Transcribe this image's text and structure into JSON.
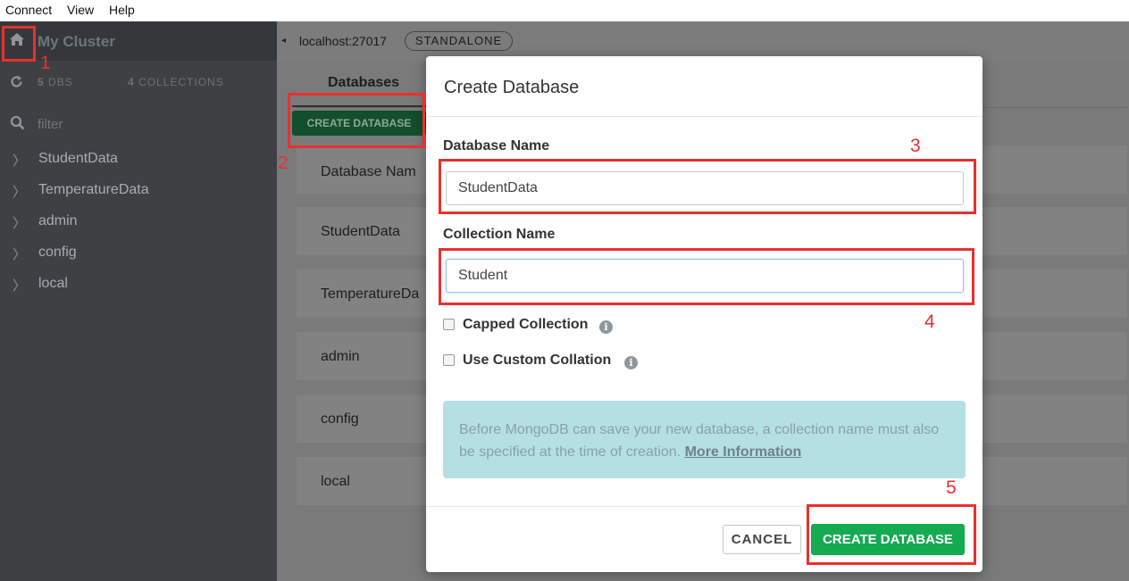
{
  "menu": [
    "Connect",
    "View",
    "Help"
  ],
  "sidebar": {
    "cluster_name": "My Cluster",
    "dbs_count": "5",
    "dbs_label": "DBS",
    "collections_count": "4",
    "collections_label": "COLLECTIONS",
    "filter_placeholder": "filter",
    "databases": [
      "StudentData",
      "TemperatureData",
      "admin",
      "config",
      "local"
    ]
  },
  "topbar": {
    "host": "localhost:27017",
    "badge": "STANDALONE"
  },
  "main": {
    "tab_databases": "Databases",
    "create_button": "CREATE DATABASE",
    "column_header": "Database Nam",
    "rows": [
      "StudentData",
      "TemperatureDa",
      "admin",
      "config",
      "local"
    ]
  },
  "modal": {
    "title": "Create Database",
    "db_name_label": "Database Name",
    "db_name_value": "StudentData",
    "coll_name_label": "Collection Name",
    "coll_name_value": "Student",
    "capped_label": "Capped Collection",
    "collation_label": "Use Custom Collation",
    "info_text": "Before MongoDB can save your new database, a collection name must also be specified at the time of creation.",
    "info_link": "More Information",
    "cancel": "CANCEL",
    "create": "CREATE DATABASE"
  },
  "annotations": [
    "1",
    "2",
    "3",
    "4",
    "5"
  ],
  "colors": {
    "sidebar_bg": "#3e4043",
    "overlay_gray": "#7a7a7a",
    "create_green": "#13aa52",
    "annotation_red": "#e8302f",
    "info_bg": "#b4e0e4"
  }
}
